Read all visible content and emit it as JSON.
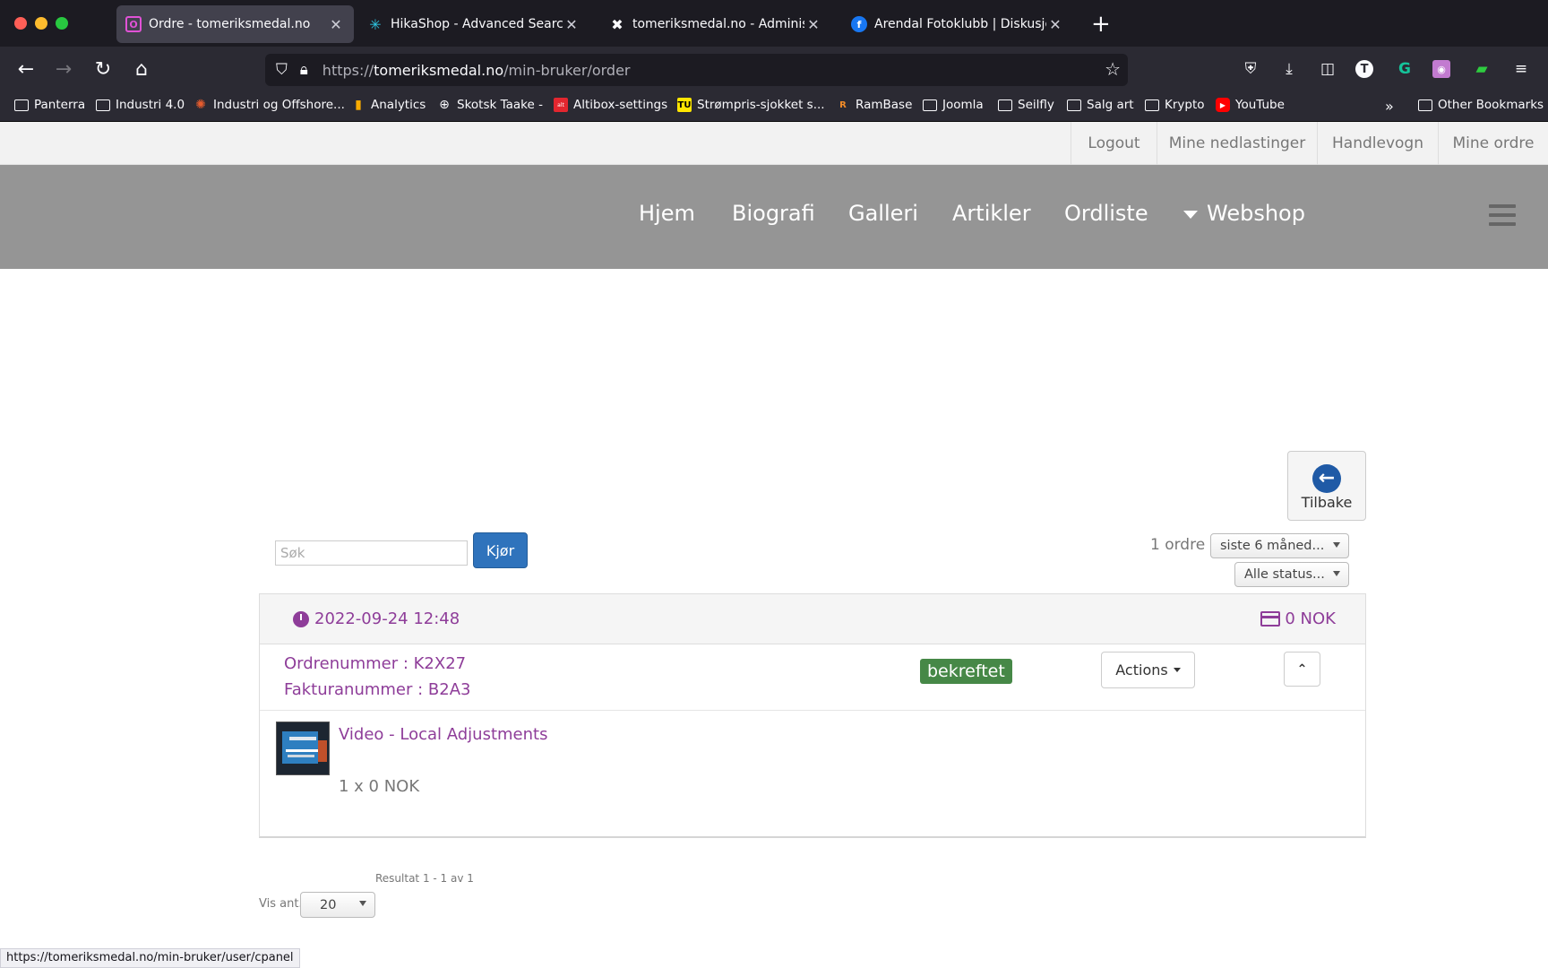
{
  "browser": {
    "tabs": [
      {
        "title": "Ordre - tomeriksmedal.no",
        "active": true
      },
      {
        "title": "HikaShop - Advanced Search - H",
        "active": false
      },
      {
        "title": "tomeriksmedal.no - Administrati",
        "active": false
      },
      {
        "title": "Arendal Fotoklubb | Diskusjon og",
        "active": false
      }
    ],
    "url_scheme": "https://",
    "url_domain": "tomeriksmedal.no",
    "url_path": "/min-bruker/order",
    "bookmarks": [
      "Panterra",
      "Industri 4.0",
      "Industri og Offshore...",
      "Analytics",
      "Skotsk Taake -",
      "Altibox-settings",
      "Strømpris-sjokket s...",
      "RamBase",
      "Joomla",
      "Seilfly",
      "Salg art",
      "Krypto",
      "YouTube"
    ],
    "other_bookmarks": "Other Bookmarks",
    "status_url": "https://tomeriksmedal.no/min-bruker/user/cpanel"
  },
  "topmenu": {
    "logout": "Logout",
    "downloads": "Mine nedlastinger",
    "cart": "Handlevogn",
    "orders": "Mine ordre"
  },
  "mainnav": {
    "items": [
      "Hjem",
      "Biografi",
      "Galleri",
      "Artikler",
      "Ordliste"
    ],
    "webshop": "Webshop"
  },
  "back_label": "Tilbake",
  "search": {
    "placeholder": "Søk",
    "value": "",
    "button": "Kjør"
  },
  "filters": {
    "count": "1 ordre",
    "period": "siste 6 måned...",
    "status": "Alle status..."
  },
  "order": {
    "date": "2022-09-24 12:48",
    "total": "0 NOK",
    "order_number": "Ordrenummer : K2X27",
    "invoice_number": "Fakturanummer : B2A3",
    "status": "bekreftet",
    "actions_label": "Actions",
    "product": {
      "name": "Video - Local Adjustments",
      "qty_line": "1 x 0 NOK"
    }
  },
  "pagination": {
    "result": "Resultat 1 - 1 av 1",
    "per_page_label": "Vis ant.",
    "per_page_value": "20"
  },
  "colors": {
    "accent": "#8e3d99",
    "button_primary": "#2f73bc",
    "status_ok": "#468847"
  }
}
